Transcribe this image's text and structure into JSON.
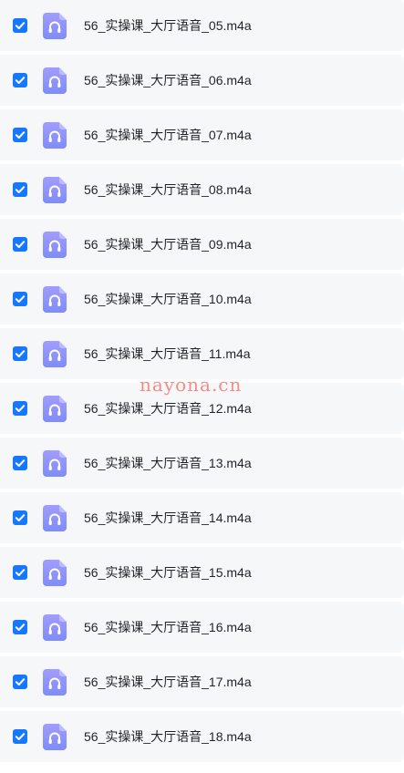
{
  "files": [
    {
      "name": "56_实操课_大厅语音_05.m4a",
      "checked": true,
      "icon": "audio-file-icon"
    },
    {
      "name": "56_实操课_大厅语音_06.m4a",
      "checked": true,
      "icon": "audio-file-icon"
    },
    {
      "name": "56_实操课_大厅语音_07.m4a",
      "checked": true,
      "icon": "audio-file-icon"
    },
    {
      "name": "56_实操课_大厅语音_08.m4a",
      "checked": true,
      "icon": "audio-file-icon"
    },
    {
      "name": "56_实操课_大厅语音_09.m4a",
      "checked": true,
      "icon": "audio-file-icon"
    },
    {
      "name": "56_实操课_大厅语音_10.m4a",
      "checked": true,
      "icon": "audio-file-icon"
    },
    {
      "name": "56_实操课_大厅语音_11.m4a",
      "checked": true,
      "icon": "audio-file-icon"
    },
    {
      "name": "56_实操课_大厅语音_12.m4a",
      "checked": true,
      "icon": "audio-file-icon"
    },
    {
      "name": "56_实操课_大厅语音_13.m4a",
      "checked": true,
      "icon": "audio-file-icon"
    },
    {
      "name": "56_实操课_大厅语音_14.m4a",
      "checked": true,
      "icon": "audio-file-icon"
    },
    {
      "name": "56_实操课_大厅语音_15.m4a",
      "checked": true,
      "icon": "audio-file-icon"
    },
    {
      "name": "56_实操课_大厅语音_16.m4a",
      "checked": true,
      "icon": "audio-file-icon"
    },
    {
      "name": "56_实操课_大厅语音_17.m4a",
      "checked": true,
      "icon": "audio-file-icon"
    },
    {
      "name": "56_实操课_大厅语音_18.m4a",
      "checked": true,
      "icon": "audio-file-icon"
    }
  ],
  "watermark": "nayona.cn",
  "colors": {
    "checkbox": "#1677ff",
    "icon_gradient_top": "#a39cff",
    "icon_gradient_bottom": "#7f8cf7",
    "row_background": "#f6f7f9",
    "watermark": "#f0837a"
  }
}
